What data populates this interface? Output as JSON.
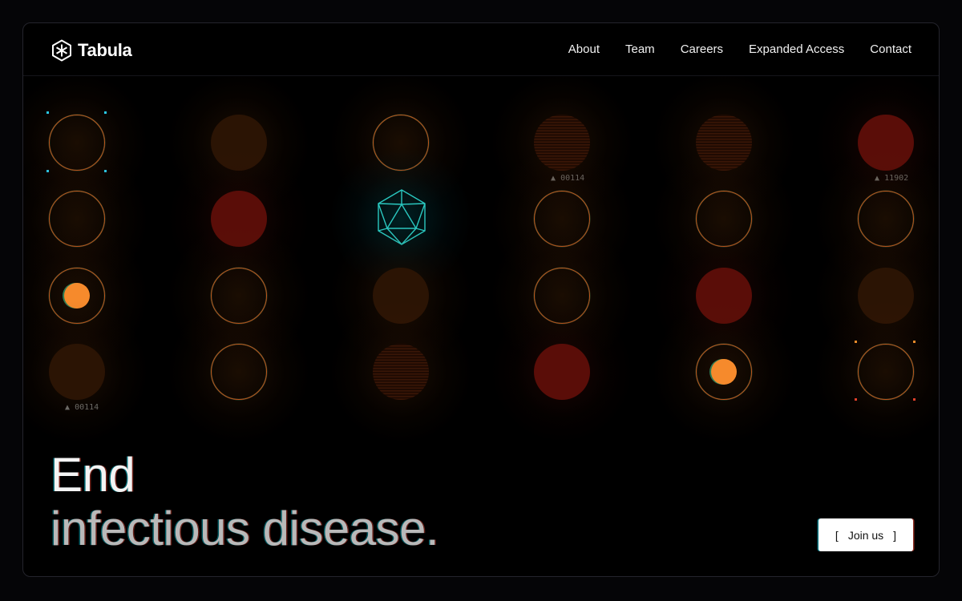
{
  "header": {
    "brand": "Tabula",
    "nav": [
      "About",
      "Team",
      "Careers",
      "Expanded Access",
      "Contact"
    ]
  },
  "grid_labels": {
    "r1c4": "00114",
    "r1c6": "11902",
    "r4c1": "00114"
  },
  "hero": {
    "line1": "End",
    "line2": "infectious disease."
  },
  "cta": {
    "open_bracket": "[",
    "label": "Join us",
    "close_bracket": "]"
  },
  "colors": {
    "accent_orange": "#f68a2c",
    "ring": "#c1561d",
    "teal": "#2ac8c0",
    "cell_red": "#5a0d08",
    "cell_brown": "#2b1404"
  },
  "icons": [
    "tabula-logo-icon",
    "icosahedron-icon",
    "triangle-marker-icon"
  ]
}
